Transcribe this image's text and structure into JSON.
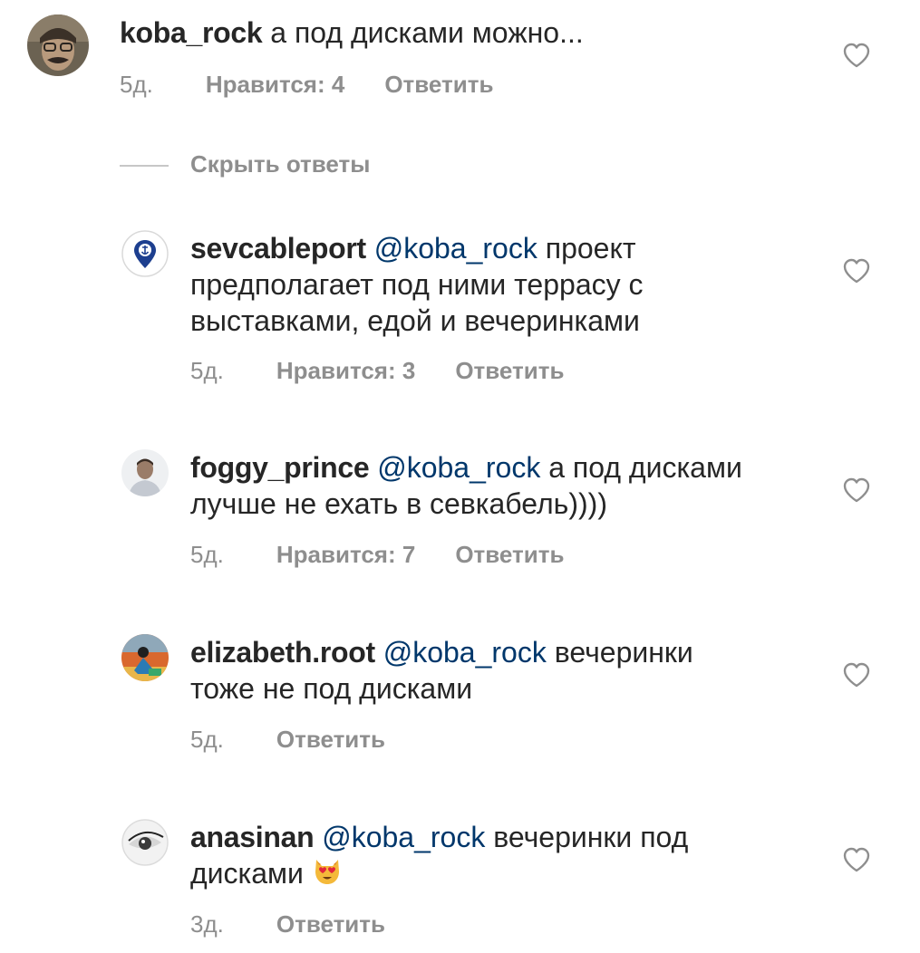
{
  "comments": [
    {
      "username": "koba_rock",
      "text": "а под дисками можно...",
      "time": "5д.",
      "likes": "Нравится: 4",
      "reply": "Ответить",
      "avatar_icon": "person-avatar-icon"
    },
    {
      "username": "sevcableport",
      "mention": "@koba_rock",
      "text_line1": " проект",
      "text_line2": "предполагает под ними террасу с",
      "text_line3": "выставками, едой и вечеринками",
      "time": "5д.",
      "likes": "Нравится: 3",
      "reply": "Ответить",
      "avatar_icon": "anchor-pin-icon"
    },
    {
      "username": "foggy_prince",
      "mention": "@koba_rock",
      "text_line1": " а под дисками",
      "text_line2": "лучше не ехать в севкабель))))",
      "time": "5д.",
      "likes": "Нравится: 7",
      "reply": "Ответить",
      "avatar_icon": "person-avatar-icon"
    },
    {
      "username": "elizabeth.root",
      "mention": "@koba_rock",
      "text_line1": " вечеринки",
      "text_line2": "тоже не под дисками",
      "time": "5д.",
      "reply": "Ответить",
      "avatar_icon": "person-avatar-icon"
    },
    {
      "username": "anasinan",
      "mention": "@koba_rock",
      "text_line1": " вечеринки под",
      "text_line2": "дисками ",
      "emoji": "heart-eyes-cat-emoji",
      "time": "3д.",
      "reply": "Ответить",
      "avatar_icon": "eye-avatar-icon"
    }
  ],
  "hide_replies_label": "Скрыть ответы",
  "colors": {
    "text": "#262626",
    "secondary": "#8e8e8e",
    "mention": "#00376b"
  }
}
